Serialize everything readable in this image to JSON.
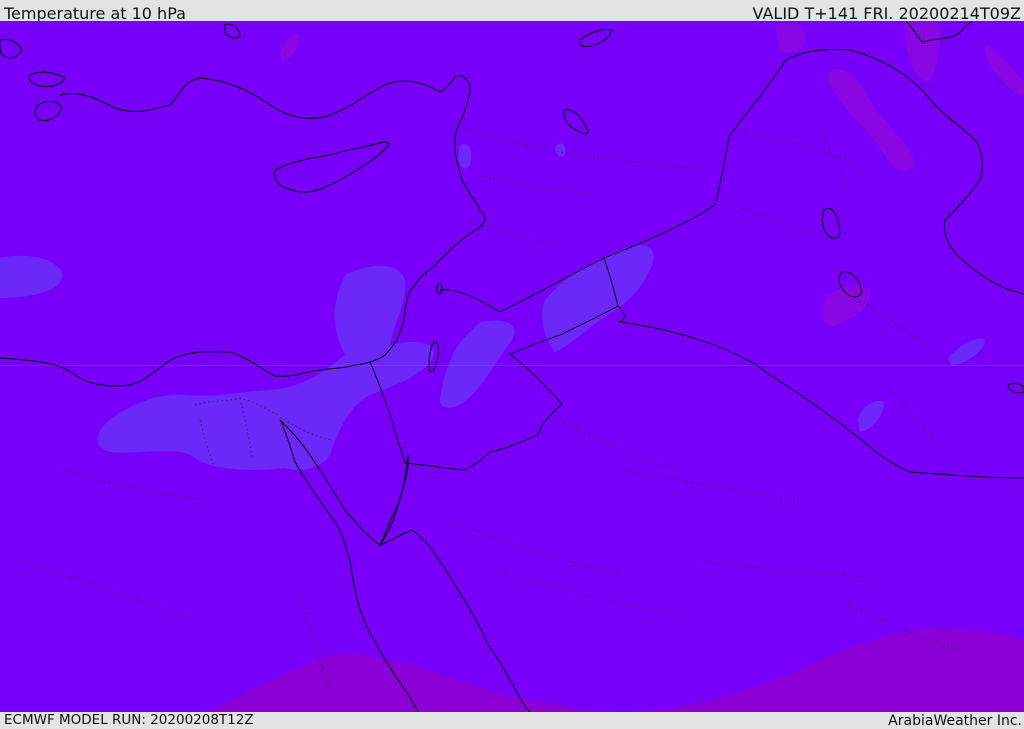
{
  "header": {
    "title": "Temperature at 10 hPa",
    "valid": "VALID T+141 FRI. 20200214T09Z"
  },
  "footer": {
    "model_run": "ECMWF MODEL RUN: 20200208T12Z",
    "credit": "ArabiaWeather Inc."
  },
  "map": {
    "field": "temperature",
    "level": "10 hPa",
    "colors": {
      "base": "#7800fb",
      "cooler": "#6a2ff8",
      "warmer": "#8a08e0",
      "warmest": "#8c00d8",
      "coastline": "#000000",
      "border_dotted": "#222222"
    }
  }
}
